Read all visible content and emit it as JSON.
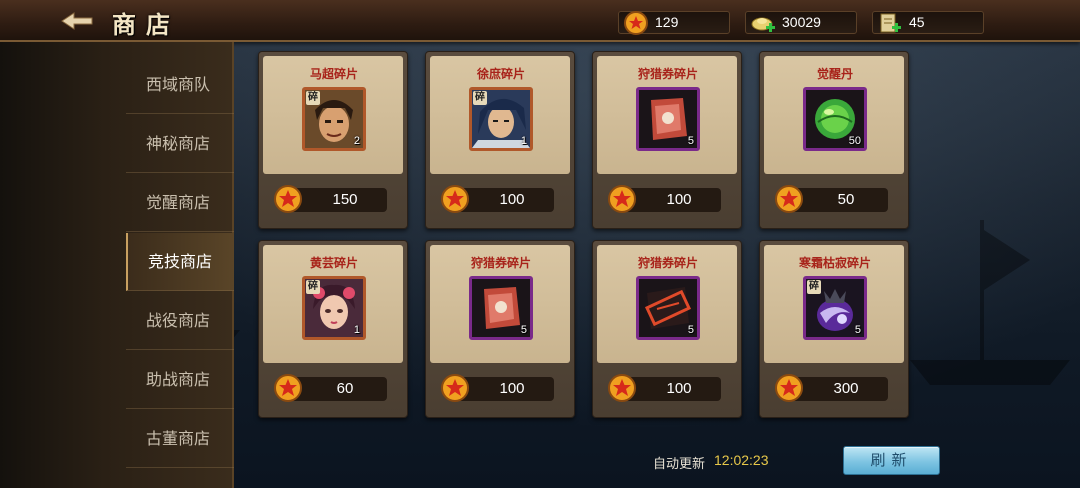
{
  "header": {
    "title": "商店",
    "resources": [
      {
        "icon": "gold-coin-icon",
        "value": "129"
      },
      {
        "icon": "silver-ingot-plus-icon",
        "value": "30029"
      },
      {
        "icon": "stamina-scroll-plus-icon",
        "value": "45"
      }
    ]
  },
  "sidebar": {
    "items": [
      {
        "label": "西域商队"
      },
      {
        "label": "神秘商店"
      },
      {
        "label": "觉醒商店"
      },
      {
        "label": "竞技商店",
        "active": true
      },
      {
        "label": "战役商店"
      },
      {
        "label": "助战商店"
      },
      {
        "label": "古董商店"
      }
    ]
  },
  "items": [
    {
      "name": "马超碎片",
      "qty": "2",
      "price": "150",
      "icon": "machao-portrait-icon"
    },
    {
      "name": "徐庶碎片",
      "qty": "1",
      "price": "100",
      "icon": "xushu-portrait-icon"
    },
    {
      "name": "狩猎券碎片",
      "qty": "5",
      "price": "100",
      "icon": "hunting-ticket-icon"
    },
    {
      "name": "觉醒丹",
      "qty": "50",
      "price": "50",
      "icon": "awakening-pill-icon"
    },
    {
      "name": "黄芸碎片",
      "qty": "1",
      "price": "60",
      "icon": "huangyun-portrait-icon"
    },
    {
      "name": "狩猎券碎片",
      "qty": "5",
      "price": "100",
      "icon": "hunting-ticket-icon"
    },
    {
      "name": "狩猎券碎片",
      "qty": "5",
      "price": "100",
      "icon": "hunting-ticket-stamped-icon"
    },
    {
      "name": "寒霜枯寂碎片",
      "qty": "5",
      "price": "300",
      "icon": "frost-orb-icon"
    }
  ],
  "fragment_tag": "碎",
  "footer": {
    "auto_refresh_label": "自动更新",
    "refresh_time": "12:02:23",
    "refresh_button": "刷新"
  },
  "colors": {
    "item_name": "#a8231a",
    "refresh_time": "#e7c84a",
    "refresh_button": "#7ec4e2"
  }
}
